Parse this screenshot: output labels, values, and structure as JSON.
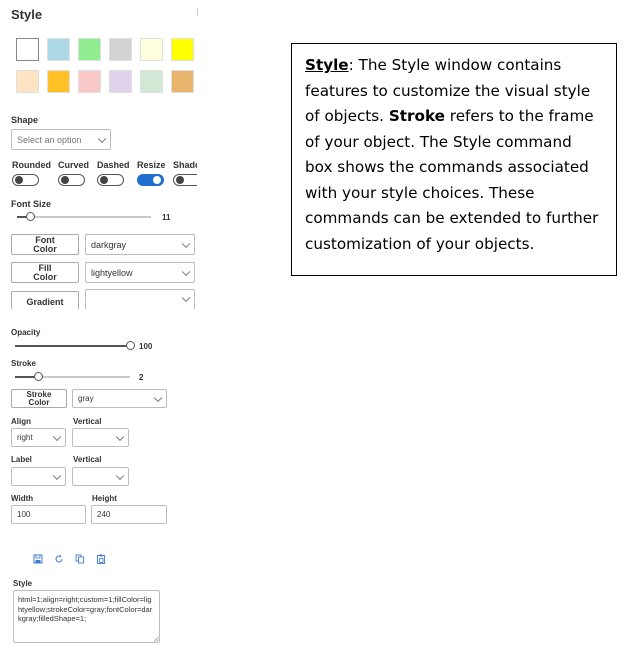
{
  "panel": {
    "title": "Style"
  },
  "colors": {
    "swatches_row1": [
      "#ffffff",
      "#add8e6",
      "#90ee90",
      "#d3d3d3",
      "#ffffe0",
      "#ffff00"
    ],
    "swatches_row2": [
      "#ffe4c4",
      "#ffc125",
      "#f9c8c8",
      "#e0d3ee",
      "#d2e8d4",
      "#e8b56e"
    ],
    "accent": "#1f6fd0"
  },
  "shape": {
    "label": "Shape",
    "placeholder": "Select an option"
  },
  "toggles": [
    {
      "label": "Rounded",
      "on": false
    },
    {
      "label": "Curved",
      "on": false
    },
    {
      "label": "Dashed",
      "on": false
    },
    {
      "label": "Resize",
      "on": true
    },
    {
      "label": "Shado",
      "on": false
    }
  ],
  "font_size": {
    "label": "Font Size",
    "value": "11",
    "fraction": 0.1
  },
  "font_color": {
    "button_line1": "Font",
    "button_line2": "Color",
    "value": "darkgray"
  },
  "fill_color": {
    "button_line1": "Fill",
    "button_line2": "Color",
    "value": "lightyellow"
  },
  "gradient": {
    "button": "Gradient",
    "value": ""
  },
  "opacity": {
    "label": "Opacity",
    "value": "100",
    "fraction": 1.0
  },
  "stroke": {
    "label": "Stroke",
    "value": "2",
    "fraction": 0.2
  },
  "stroke_color": {
    "button_line1": "Stroke",
    "button_line2": "Color",
    "value": "gray"
  },
  "align": {
    "label": "Align",
    "value": "right",
    "vertical_label": "Vertical",
    "vertical_value": ""
  },
  "label_row": {
    "label": "Label",
    "value": "",
    "vertical_label": "Vertical",
    "vertical_value": ""
  },
  "size": {
    "width_label": "Width",
    "width_value": "100",
    "height_label": "Height",
    "height_value": "240"
  },
  "toolbar_icons": [
    "save-icon",
    "refresh-icon",
    "copy-icon",
    "paste-icon"
  ],
  "style_box": {
    "label": "Style",
    "value": "html=1;align=right;custom=1;fillColor=lightyellow;strokeColor=gray;fontColor=darkgray;filledShape=1;"
  },
  "callout": {
    "heading": "Style",
    "p1": ": The Style window contains features to customize the visual style of objects. ",
    "bold1": "Stroke",
    "p2": " refers to the frame of your object. The Style command box shows the commands associated with your style choices. These commands can be extended to further customization of your objects."
  }
}
